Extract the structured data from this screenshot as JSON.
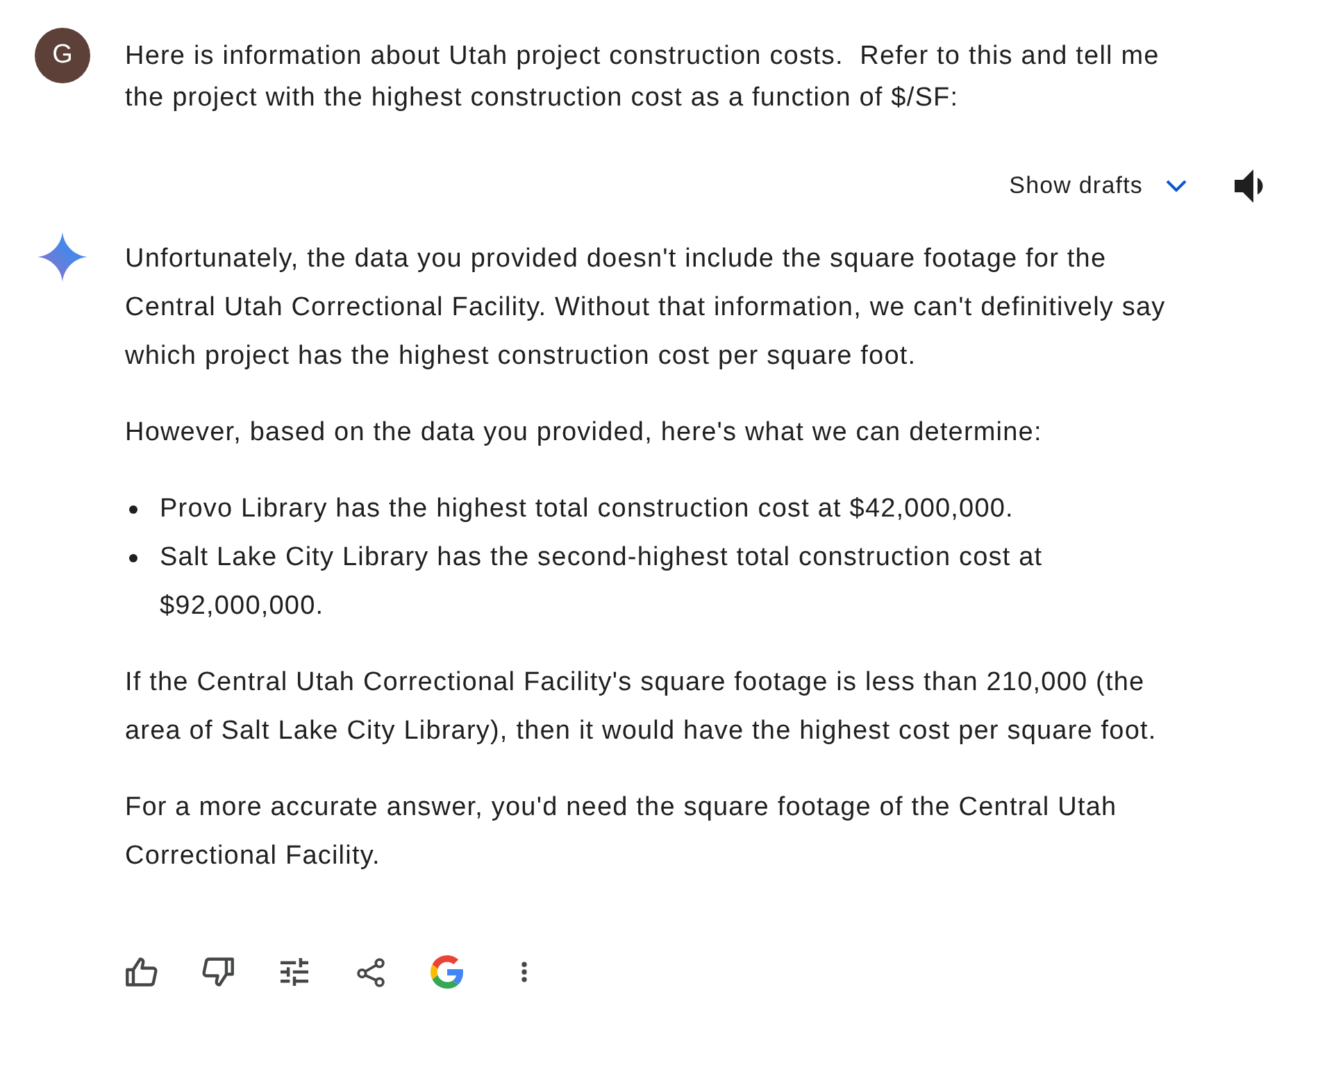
{
  "user_message": {
    "avatar": "G",
    "text": "Here is information about Utah project construction costs.  Refer to this and tell me the project with the highest construction cost as a function of $/SF:"
  },
  "response_header": {
    "show_drafts": "Show drafts",
    "drafts_expanded": false
  },
  "response": {
    "blocks": [
      {
        "kind": "paragraph",
        "text": "Unfortunately, the data you provided doesn't include the square footage for the Central Utah Correctional Facility. Without that information, we can't definitively say which project has the highest construction cost per square foot."
      },
      {
        "kind": "paragraph",
        "text": "However, based on the data you provided, here's what we can determine:"
      },
      {
        "kind": "bullets",
        "items": [
          "Provo Library has the highest total construction cost at $42,000,000.",
          "Salt Lake City Library has the second-highest total construction cost at $92,000,000."
        ]
      },
      {
        "kind": "paragraph",
        "text": "If the Central Utah Correctional Facility's square footage is less than 210,000 (the area of Salt Lake City Library), then it would have the highest cost per square foot."
      },
      {
        "kind": "paragraph",
        "text": "For a more accurate answer, you'd need the square footage of the Central Utah Correctional Facility."
      }
    ]
  }
}
